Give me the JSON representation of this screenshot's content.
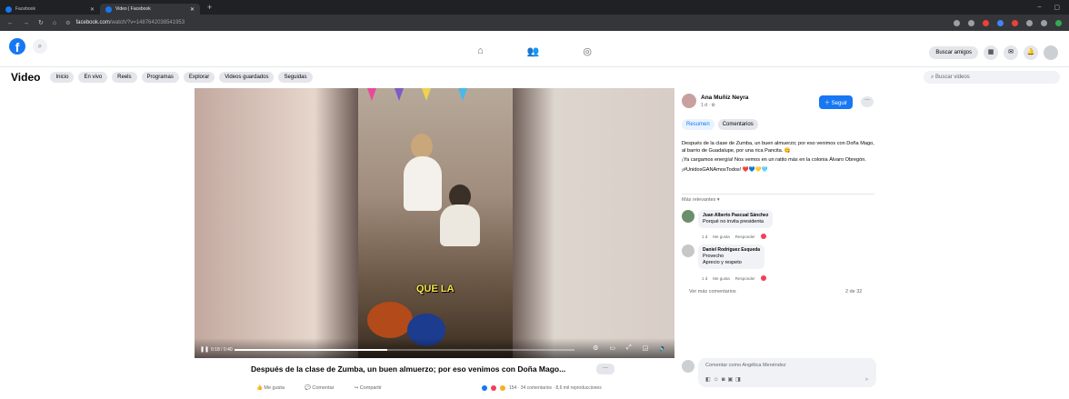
{
  "browser": {
    "tabs": [
      {
        "label": "Facebook"
      },
      {
        "label": "Video | Facebook"
      }
    ],
    "url_host": "facebook.com",
    "url_path": "/watch/?v=1487642038541953"
  },
  "header": {
    "find_friends": "Buscar amigos"
  },
  "video_nav": {
    "title": "Video",
    "pills": [
      "Inicio",
      "En vivo",
      "Reels",
      "Programas",
      "Explorar",
      "Videos guardados",
      "Seguidas"
    ],
    "search_placeholder": "Buscar videos"
  },
  "player": {
    "caption": "QUE LA",
    "time": "0:18 / 0:40",
    "progress_fraction": 0.45
  },
  "video_info": {
    "title": "Después de la clase de Zumba, un buen almuerzo; por eso venimos con Doña Mago...",
    "more": "···",
    "actions": [
      "Me gusta",
      "Comentar",
      "Compartir"
    ],
    "stats": "154 · 34 comentarios · 8,6 mil reproducciones"
  },
  "panel": {
    "author": "Ana Muñiz Neyra",
    "meta": "1 d · ⚙",
    "follow": "Seguir",
    "tabs": [
      "Resumen",
      "Comentarios"
    ],
    "post_p1": "Después de la clase de Zumba, un buen almuerzo; por eso venimos con Doña Mago, al barrio de Guadalupe, por una rica Pancita. 😋",
    "post_p2": "¡Ya cargamos energía! Nos vemos en un ratito más en la colonia Álvaro Obregón.",
    "post_p3": "¡#UnidosGANAmosTodos! ❤️💙💛🩵",
    "relevance": "Más relevantes ▾",
    "comments": [
      {
        "author": "Juan Alberto Pascual Sánchez",
        "text": "Porqué no invita presidenta",
        "time": "1 d",
        "like": "Me gusta",
        "reply": "Responder"
      },
      {
        "author": "Daniel Rodríguez Esqueda",
        "text": "Provecho",
        "text2": "Aprecio y respeto",
        "time": "1 d",
        "like": "Me gusta",
        "reply": "Responder"
      }
    ],
    "see_more": "Ver más comentarios",
    "page_count": "2 de 32",
    "composer_placeholder": "Comentar como Angélica Menéndez"
  }
}
